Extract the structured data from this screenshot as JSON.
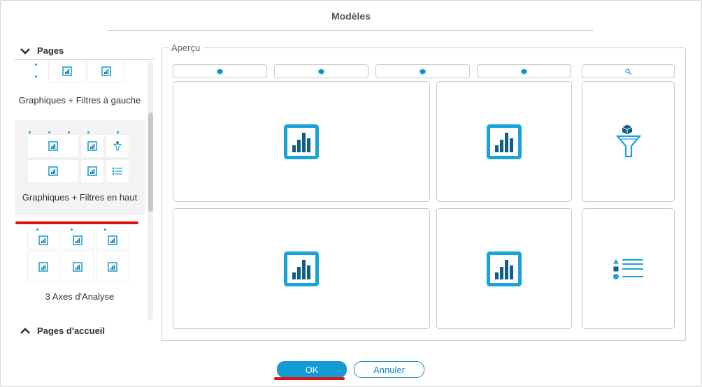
{
  "dialog": {
    "title": "Modèles"
  },
  "sidebar": {
    "pages_header": "Pages",
    "home_pages_header": "Pages d'accueil",
    "templates": [
      {
        "label": "Graphiques + Filtres à gauche",
        "selected": false
      },
      {
        "label": "Graphiques + Filtres en haut",
        "selected": true
      },
      {
        "label": "3 Axes d'Analyse",
        "selected": false
      }
    ]
  },
  "preview": {
    "label": "Aperçu",
    "filter_bar_icons": [
      "cube-icon",
      "cube-icon",
      "cube-icon",
      "cube-icon",
      "search-icon"
    ],
    "cards": [
      {
        "icon": "bar-chart-icon"
      },
      {
        "icon": "bar-chart-icon"
      },
      {
        "icon": "funnel-filter-icon"
      },
      {
        "icon": "bar-chart-icon"
      },
      {
        "icon": "bar-chart-icon"
      },
      {
        "icon": "list-legend-icon"
      }
    ]
  },
  "buttons": {
    "ok_label": "OK",
    "cancel_label": "Annuler"
  },
  "colors": {
    "accent": "#139bd6",
    "icon_blue": "#19a3db",
    "icon_dark": "#0f5f86",
    "highlight_red": "#e01010"
  }
}
